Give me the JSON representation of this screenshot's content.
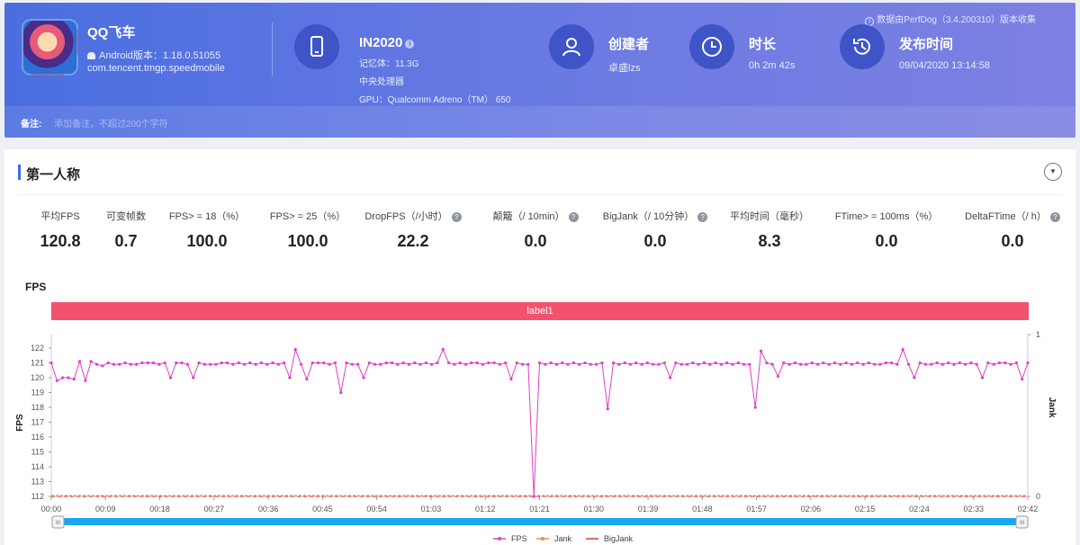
{
  "source": {
    "text": "数据由PerfDog（3.4.200310）版本收集"
  },
  "app": {
    "name": "QQ飞车",
    "version": "Android版本：1.18.0.51055",
    "package": "com.tencent.tmgp.speedmobile"
  },
  "device": {
    "name": "IN2020",
    "memory": "记忆体：11.3G",
    "cpu": "中央处理器",
    "gpu": "GPU：Qualcomm Adreno（TM） 650"
  },
  "creator": {
    "title": "创建者",
    "value": "卓盛lzs"
  },
  "duration": {
    "title": "时长",
    "value": "0h 2m 42s"
  },
  "publish": {
    "title": "发布时间",
    "value": "09/04/2020 13:14:58"
  },
  "note": {
    "label": "备注:",
    "placeholder": "添加备注，不超过200个字符"
  },
  "section": {
    "title": "第一人称"
  },
  "metrics": [
    {
      "label": "平均FPS",
      "value": "120.8",
      "help": false
    },
    {
      "label": "可变帧数",
      "value": "0.7",
      "help": false
    },
    {
      "label": "FPS> = 18（%）",
      "value": "100.0",
      "help": false
    },
    {
      "label": "FPS> = 25（%）",
      "value": "100.0",
      "help": false
    },
    {
      "label": "DropFPS（/小时）",
      "value": "22.2",
      "help": true
    },
    {
      "label": "颠簸（/ 10min）",
      "value": "0.0",
      "help": true
    },
    {
      "label": "BigJank（/ 10分钟）",
      "value": "0.0",
      "help": true
    },
    {
      "label": "平均时间（毫秒）",
      "value": "8.3",
      "help": false
    },
    {
      "label": "FTime> = 100ms（%）",
      "value": "0.0",
      "help": false
    },
    {
      "label": "DeltaFTime（/ h）",
      "value": "0.0",
      "help": true
    }
  ],
  "colors": {
    "fps": "#e040c8",
    "jank": "#f08c3c",
    "bigjank": "#e63232",
    "label_bar": "#f2526d",
    "slider": "#1aa7f0"
  },
  "chart_data": {
    "type": "line",
    "title": "FPS",
    "label_bar": "label1",
    "ylabel": "FPS",
    "y2label": "Jank",
    "ylim": [
      112,
      122
    ],
    "y2lim": [
      0,
      1
    ],
    "yticks": [
      "112",
      "113",
      "114",
      "115",
      "116",
      "117",
      "118",
      "119",
      "120",
      "121",
      "122"
    ],
    "y2ticks": [
      "0",
      "1"
    ],
    "xlim": [
      0,
      162
    ],
    "xticks": [
      "00:00",
      "00:09",
      "00:18",
      "00:27",
      "00:36",
      "00:45",
      "00:54",
      "01:03",
      "01:12",
      "01:21",
      "01:30",
      "01:39",
      "01:48",
      "01:57",
      "02:06",
      "02:15",
      "02:24",
      "02:33",
      "02:42"
    ],
    "legend": [
      "FPS",
      "Jank",
      "BigJank"
    ],
    "legend_position": "bottom",
    "series": [
      {
        "name": "FPS",
        "values": [
          121,
          119.8,
          120,
          120,
          119.9,
          121.1,
          119.8,
          121.1,
          120.9,
          120.8,
          121,
          120.9,
          120.9,
          121,
          120.9,
          120.9,
          121,
          121,
          121,
          120.9,
          121,
          120,
          121,
          121,
          120.9,
          120,
          121,
          120.9,
          120.9,
          120.9,
          121,
          121,
          120.9,
          121,
          120.9,
          121,
          120.9,
          121,
          120.9,
          121,
          120.9,
          121,
          120,
          121.9,
          120.9,
          119.9,
          121,
          121,
          121,
          120.9,
          121,
          119,
          121,
          120.9,
          120.9,
          120,
          121,
          120.9,
          120.9,
          121,
          121,
          120.9,
          121,
          120.9,
          121,
          120.9,
          121,
          120.9,
          121,
          121.9,
          121,
          120.9,
          121,
          120.9,
          121,
          121,
          120.9,
          121,
          121,
          120.9,
          121,
          119.9,
          121,
          120.9,
          120.9,
          112,
          121,
          120.9,
          121,
          120.9,
          121,
          120.9,
          121,
          120.9,
          121,
          120.9,
          120.9,
          121,
          117.9,
          121,
          120.9,
          121,
          120.9,
          121,
          120.9,
          121,
          120.9,
          120.9,
          121,
          120,
          121,
          120.9,
          120.9,
          121,
          120.9,
          121,
          120.9,
          121,
          120.9,
          121,
          120.9,
          121,
          120.9,
          120.9,
          118,
          121.8,
          121,
          120.9,
          120.1,
          121,
          120.9,
          121,
          120.9,
          120.9,
          121,
          120.9,
          121,
          120.9,
          121,
          120.9,
          121,
          120.9,
          121,
          120.9,
          121,
          120.9,
          120.9,
          121,
          121,
          120.9,
          121.9,
          120.9,
          120,
          121,
          120.9,
          120.9,
          121,
          120.9,
          121,
          120.9,
          121,
          120.9,
          121,
          120.9,
          120,
          121,
          120.9,
          121,
          121,
          120.9,
          121,
          119.9,
          121
        ]
      },
      {
        "name": "Jank",
        "values": [
          0,
          0
        ]
      },
      {
        "name": "BigJank",
        "values": [
          0,
          0
        ]
      }
    ]
  }
}
